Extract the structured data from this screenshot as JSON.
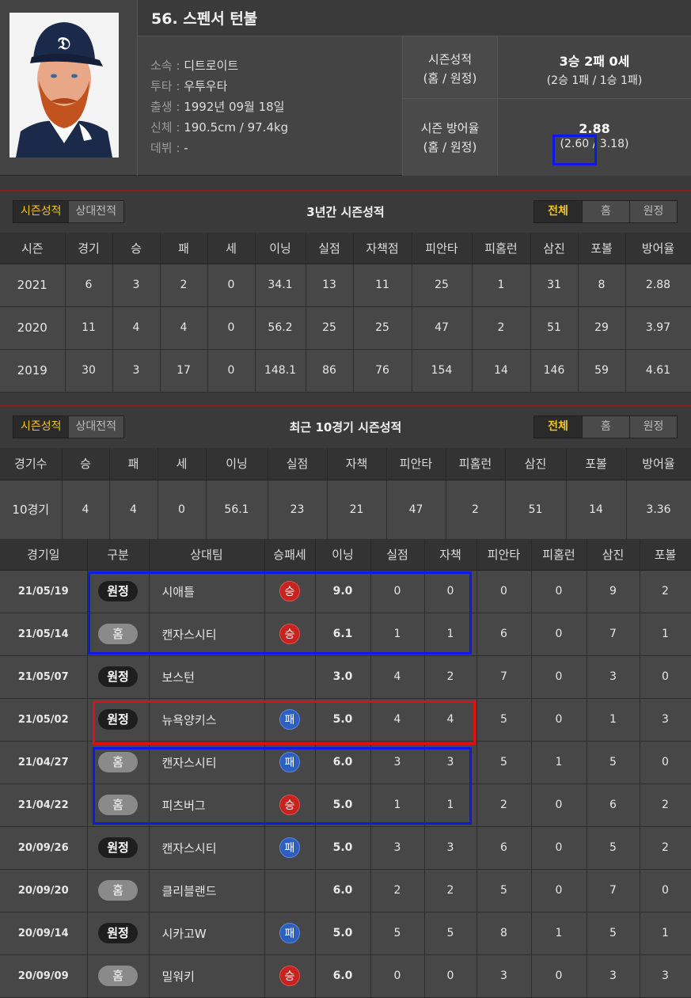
{
  "player": {
    "title": "56. 스펜서 턴불",
    "info": [
      {
        "k": "소속 : ",
        "v": "디트로이트"
      },
      {
        "k": "투타 : ",
        "v": "우투우타"
      },
      {
        "k": "출생 : ",
        "v": "1992년 09월 18일"
      },
      {
        "k": "신체 : ",
        "v": "190.5cm / 97.4kg"
      },
      {
        "k": "데뷔 : ",
        "v": "-"
      }
    ],
    "record_label_1": "시즌성적",
    "record_label_2": "(홈 / 원정)",
    "record_main": "3승 2패 0세",
    "record_sub": "(2승 1패 / 1승 1패)",
    "era_label_1": "시즌 방어율",
    "era_label_2": "(홈 / 원정)",
    "era_main": "2.88",
    "era_sub": "(2.60 / 3.18)"
  },
  "season": {
    "tab_season": "시즌성적",
    "tab_vs": "상대전적",
    "title": "3년간 시즌성적",
    "filters": [
      "전체",
      "홈",
      "원정"
    ],
    "headers": [
      "시즌",
      "경기",
      "승",
      "패",
      "세",
      "이닝",
      "실점",
      "자책점",
      "피안타",
      "피홈런",
      "삼진",
      "포볼",
      "방어율"
    ],
    "rows": [
      [
        "2021",
        "6",
        "3",
        "2",
        "0",
        "34.1",
        "13",
        "11",
        "25",
        "1",
        "31",
        "8",
        "2.88"
      ],
      [
        "2020",
        "11",
        "4",
        "4",
        "0",
        "56.2",
        "25",
        "25",
        "47",
        "2",
        "51",
        "29",
        "3.97"
      ],
      [
        "2019",
        "30",
        "3",
        "17",
        "0",
        "148.1",
        "86",
        "76",
        "154",
        "14",
        "146",
        "59",
        "4.61"
      ]
    ]
  },
  "recent": {
    "tab_season": "시즌성적",
    "tab_vs": "상대전적",
    "title": "최근 10경기 시즌성적",
    "filters": [
      "전체",
      "홈",
      "원정"
    ],
    "summary_headers": [
      "경기수",
      "승",
      "패",
      "세",
      "이닝",
      "실점",
      "자책",
      "피안타",
      "피홈런",
      "삼진",
      "포볼",
      "방어율"
    ],
    "summary": [
      "10경기",
      "4",
      "4",
      "0",
      "56.1",
      "23",
      "21",
      "47",
      "2",
      "51",
      "14",
      "3.36"
    ],
    "game_headers": [
      "경기일",
      "구분",
      "상대팀",
      "승패세",
      "이닝",
      "실점",
      "자책",
      "피안타",
      "피홈런",
      "삼진",
      "포볼"
    ],
    "games": [
      {
        "date": "21/05/19",
        "type": "원정",
        "opp": "시애틀",
        "res": "승",
        "ip": "9.0",
        "r": "0",
        "er": "0",
        "h": "0",
        "hr": "0",
        "so": "9",
        "bb": "2"
      },
      {
        "date": "21/05/14",
        "type": "홈",
        "opp": "캔자스시티",
        "res": "승",
        "ip": "6.1",
        "r": "1",
        "er": "1",
        "h": "6",
        "hr": "0",
        "so": "7",
        "bb": "1"
      },
      {
        "date": "21/05/07",
        "type": "원정",
        "opp": "보스턴",
        "res": "",
        "ip": "3.0",
        "r": "4",
        "er": "2",
        "h": "7",
        "hr": "0",
        "so": "3",
        "bb": "0"
      },
      {
        "date": "21/05/02",
        "type": "원정",
        "opp": "뉴욕양키스",
        "res": "패",
        "ip": "5.0",
        "r": "4",
        "er": "4",
        "h": "5",
        "hr": "0",
        "so": "1",
        "bb": "3"
      },
      {
        "date": "21/04/27",
        "type": "홈",
        "opp": "캔자스시티",
        "res": "패",
        "ip": "6.0",
        "r": "3",
        "er": "3",
        "h": "5",
        "hr": "1",
        "so": "5",
        "bb": "0"
      },
      {
        "date": "21/04/22",
        "type": "홈",
        "opp": "피츠버그",
        "res": "승",
        "ip": "5.0",
        "r": "1",
        "er": "1",
        "h": "2",
        "hr": "0",
        "so": "6",
        "bb": "2"
      },
      {
        "date": "20/09/26",
        "type": "원정",
        "opp": "캔자스시티",
        "res": "패",
        "ip": "5.0",
        "r": "3",
        "er": "3",
        "h": "6",
        "hr": "0",
        "so": "5",
        "bb": "2"
      },
      {
        "date": "20/09/20",
        "type": "홈",
        "opp": "클리블랜드",
        "res": "",
        "ip": "6.0",
        "r": "2",
        "er": "2",
        "h": "5",
        "hr": "0",
        "so": "7",
        "bb": "0"
      },
      {
        "date": "20/09/14",
        "type": "원정",
        "opp": "시카고W",
        "res": "패",
        "ip": "5.0",
        "r": "5",
        "er": "5",
        "h": "8",
        "hr": "1",
        "so": "5",
        "bb": "1"
      },
      {
        "date": "20/09/09",
        "type": "홈",
        "opp": "밀워키",
        "res": "승",
        "ip": "6.0",
        "r": "0",
        "er": "0",
        "h": "3",
        "hr": "0",
        "so": "3",
        "bb": "3"
      }
    ]
  },
  "colors": {
    "accent": "#f5c518",
    "win": "#c8231e",
    "loss": "#2d5fc0",
    "highlight_blue": "#1018e8",
    "highlight_red": "#e01010"
  }
}
